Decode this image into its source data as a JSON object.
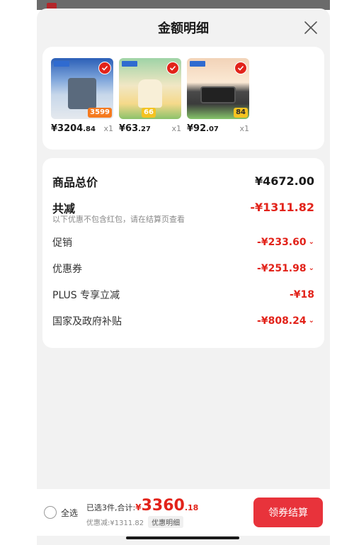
{
  "sheet": {
    "title": "金额明细"
  },
  "products": [
    {
      "price_main": "¥3204",
      "price_dec": ".84",
      "qty": "x1",
      "promo": "3599",
      "icon": "water-heater-image"
    },
    {
      "price_main": "¥63",
      "price_dec": ".27",
      "qty": "x1",
      "promo": "66",
      "icon": "food-processor-image"
    },
    {
      "price_main": "¥92",
      "price_dec": ".07",
      "qty": "x1",
      "promo": "84",
      "icon": "oven-image"
    }
  ],
  "summary": {
    "total_label": "商品总价",
    "total_value": "¥4672.00",
    "discount_label": "共减",
    "discount_value": "-¥1311.82",
    "discount_note": "以下优惠不包含红包，请在结算页查看",
    "promo_label": "促销",
    "promo_value": "-¥233.60",
    "coupon_label": "优惠券",
    "coupon_value": "-¥251.98",
    "plus_label": "PLUS 专享立减",
    "plus_value": "-¥18",
    "subsidy_label": "国家及政府补贴",
    "subsidy_value": "-¥808.24"
  },
  "bottom": {
    "select_all": "全选",
    "selected_text": "已选3件,合计:",
    "currency": "¥",
    "total_int": "3360",
    "total_dec": ".18",
    "saved_text": "优惠减:¥1311.82",
    "detail_tag": "优惠明细",
    "checkout": "领券结算"
  },
  "colors": {
    "accent": "#e2231a",
    "button": "#e8333b",
    "sheet_bg": "#f2f2f2"
  }
}
